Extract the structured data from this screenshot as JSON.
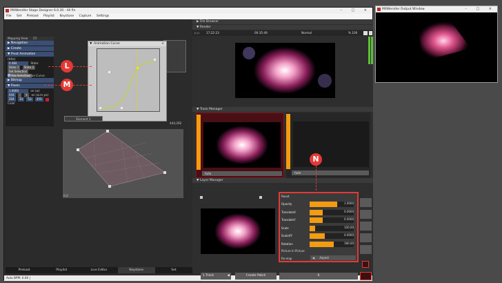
{
  "main_window": {
    "title": "MXWendler Stage Designer 6.0.30 - All fin",
    "controls": [
      "–",
      "□",
      "×"
    ]
  },
  "menu": [
    "File",
    "Set",
    "Preload",
    "Playlist",
    "Keystone",
    "Capture",
    "Settings"
  ],
  "side_panel": {
    "mapping_view": "Mapping View",
    "mapping_view_count": "(7)",
    "sections": [
      "Navigation",
      "Create",
      "Pivot Animation"
    ],
    "pivot_value": "(title)",
    "state_value": "0.484",
    "state_label": "State",
    "state_buttons": [
      "State 1",
      "State 2"
    ],
    "selection_buttons": [
      "Set Selection",
      "Show Selection"
    ],
    "show_curve": "Show Animation Curve",
    "bitmap": "Bitmap",
    "pixels": "Pixels",
    "pixel_value": "1.0000",
    "pixel_value_label": "on (w)",
    "res_value": "444",
    "res_label": "on (w.m px)",
    "color_values": [
      "204",
      "33",
      "53",
      "255"
    ],
    "color_label": "Color"
  },
  "animation_dialog": {
    "title": "Animation Curve"
  },
  "markers": {
    "l": "L",
    "m": "M",
    "n": "N"
  },
  "mesh": {
    "element_label": "Element 1",
    "coord_right": "444,292",
    "coord_left": "0,0"
  },
  "bottom_tabs": [
    "Preload",
    "Playlist",
    "Live Editor",
    "Keystone",
    "Set"
  ],
  "status_text": "Auto BPM: 0.00 |",
  "file_browser": {
    "title": "File Browser"
  },
  "render": {
    "title": "Render",
    "time_left": "17:22:23",
    "time_right": "00:35:49",
    "blend": "Normal",
    "percent": "% 100"
  },
  "track_manager": {
    "title": "Track Manager",
    "track1_label": "fade",
    "track2_label": "fade"
  },
  "layer_manager": {
    "title": "Layer Manager",
    "reset": "Reset",
    "props": [
      {
        "name": "Opacity",
        "value": "1.0000",
        "fill": 0.62
      },
      {
        "name": "TranslateX",
        "value": "0.0000",
        "fill": 0.3
      },
      {
        "name": "TranslateY",
        "value": "0.0000",
        "fill": 0.3
      },
      {
        "name": "Scale",
        "value": "100.00",
        "fill": 0.12
      },
      {
        "name": "ScaleXY",
        "value": "0.0000",
        "fill": 0.35
      },
      {
        "name": "Rotation",
        "value": "180.00",
        "fill": 0.55
      }
    ],
    "pip": "Picture In Picture",
    "remap": "Re-map",
    "remap_value": "Aspect",
    "track_select": "1 Track",
    "create_patch": "Create Patch",
    "slot": "6"
  },
  "output_window": {
    "title": "MXWendler Output Window"
  }
}
